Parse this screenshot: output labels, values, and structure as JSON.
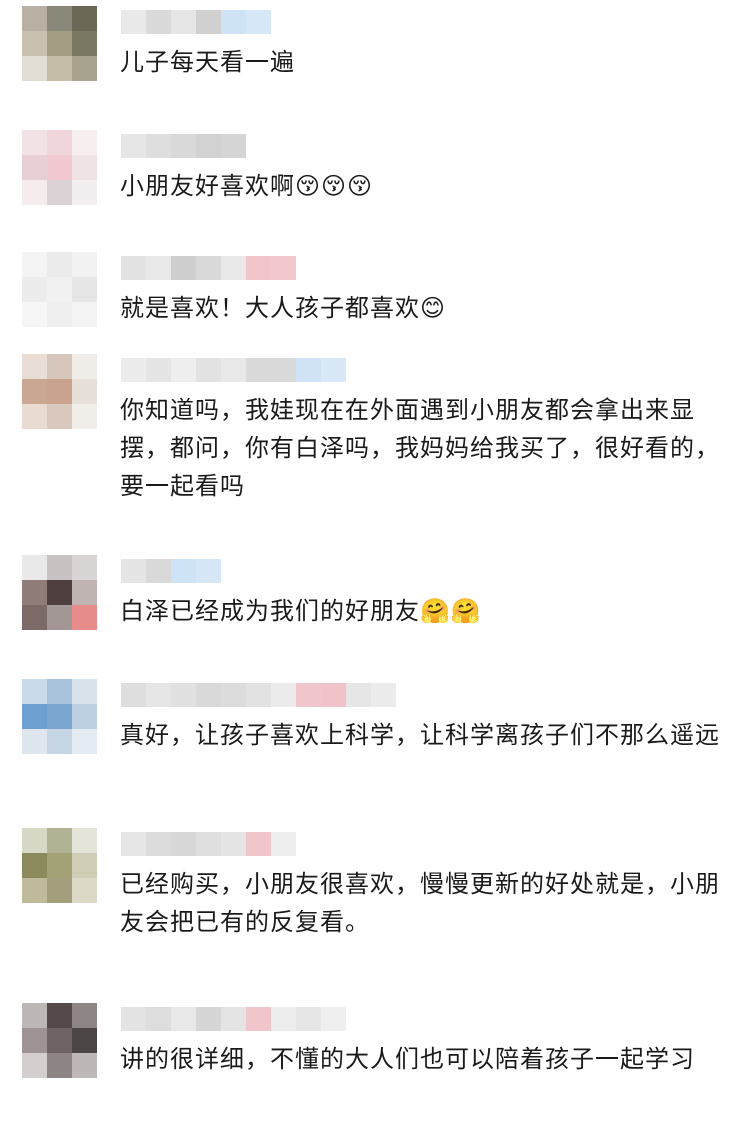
{
  "comments": [
    {
      "text": "儿子每天看一遍",
      "avatar_colors": [
        "#b8b0a2",
        "#8a8878",
        "#6b6956",
        "#c9c1b0",
        "#a39d84",
        "#7b7963",
        "#e2ded4",
        "#c4bea9",
        "#a9a48f"
      ],
      "name_colors": [
        "#e9e9e9",
        "#dadada",
        "#e6e6e6",
        "#d0d0d0",
        "#cfe3f7",
        "#d6e7f7"
      ]
    },
    {
      "text": "小朋友好喜欢啊😚😚😚",
      "avatar_colors": [
        "#f3e2e5",
        "#f0d6da",
        "#f7eef0",
        "#e8cfd4",
        "#f2c9d0",
        "#eee4e6",
        "#f5eded",
        "#dcd3d6",
        "#f3eff0"
      ],
      "name_colors": [
        "#e6e6e6",
        "#dedede",
        "#d9d9d9",
        "#d2d2d2",
        "#d5d5d5"
      ]
    },
    {
      "text": "就是喜欢！大人孩子都喜欢😊",
      "avatar_colors": [
        "#f4f4f4",
        "#ebebeb",
        "#f2f2f2",
        "#ececec",
        "#f1f1f1",
        "#e6e6e6",
        "#f6f6f6",
        "#efefef",
        "#f3f3f3"
      ],
      "name_colors": [
        "#e2e2e2",
        "#e8e8e8",
        "#cfcfcf",
        "#d9d9d9",
        "#e8e8e8",
        "#f1c4cb",
        "#f1c8ce"
      ]
    },
    {
      "text": "你知道吗，我娃现在在外面遇到小朋友都会拿出来显摆，都问，你有白泽吗，我妈妈给我买了，很好看的，要一起看吗",
      "avatar_colors": [
        "#e9ded6",
        "#d6c6bb",
        "#f0ece8",
        "#c9a792",
        "#c9a38e",
        "#e7dfd9",
        "#eadbd2",
        "#d8c8bd",
        "#f1eeea"
      ],
      "name_colors": [
        "#ececec",
        "#e5e5e5",
        "#eeeeee",
        "#e2e2e2",
        "#e8e8e8",
        "#d9d9d9",
        "#dadada",
        "#cfe2f6",
        "#d9e8f6"
      ]
    },
    {
      "text": "白泽已经成为我们的好朋友🤗🤗",
      "avatar_colors": [
        "#e9e9e9",
        "#c8c2c2",
        "#d9d5d5",
        "#8f7d7a",
        "#4e3f3e",
        "#bfb4b2",
        "#7c6a69",
        "#a39796",
        "#e88b8b"
      ],
      "name_colors": [
        "#e5e5e5",
        "#d9d9d9",
        "#cfe3f7",
        "#d6e6f7"
      ]
    },
    {
      "text": "真好，让孩子喜欢上科学，让科学离孩子们不那么遥远",
      "avatar_colors": [
        "#c9dbea",
        "#a9c3dd",
        "#d9e3ec",
        "#6ea0d1",
        "#7aa6cf",
        "#bcd0e2",
        "#dfe6ee",
        "#c6d5e3",
        "#e4ebf2"
      ],
      "name_colors": [
        "#dedede",
        "#e6e6e6",
        "#e1e1e1",
        "#d9d9d9",
        "#dcdcdc",
        "#e2e2e2",
        "#ececec",
        "#f1c5cc",
        "#f1c2ca",
        "#e6e6e6",
        "#ececec"
      ]
    },
    {
      "text": "已经购买，小朋友很喜欢，慢慢更新的好处就是，小朋友会把已有的反复看。",
      "avatar_colors": [
        "#d7d8c5",
        "#b2b294",
        "#e5e4d8",
        "#8a8a5c",
        "#a3a276",
        "#cfcdb5",
        "#bfbb9a",
        "#a39f7d",
        "#dcd9c7"
      ],
      "name_colors": [
        "#e6e6e6",
        "#dcdcdc",
        "#d7d7d7",
        "#dfdfdf",
        "#e5e5e5",
        "#f0c4cb",
        "#eeeeee"
      ]
    },
    {
      "text": "讲的很详细，不懂的大人们也可以陪着孩子一起学习",
      "avatar_colors": [
        "#bdb7b6",
        "#544a49",
        "#8d8685",
        "#9e9493",
        "#6e6463",
        "#4c4545",
        "#d4cfce",
        "#8d8584",
        "#bdb8b7"
      ],
      "name_colors": [
        "#e3e3e3",
        "#dddddd",
        "#e8e8e8",
        "#d6d6d6",
        "#e4e4e4",
        "#f0c6cc",
        "#ededed",
        "#e6e6e6",
        "#efefef"
      ]
    }
  ]
}
